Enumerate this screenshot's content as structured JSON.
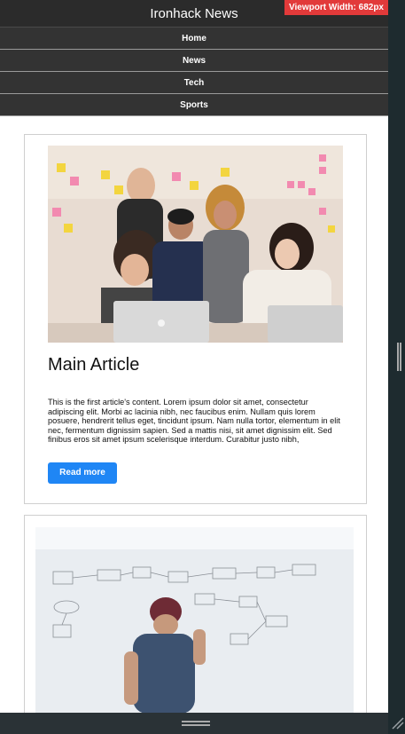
{
  "header": {
    "title": "Ironhack News",
    "viewport_badge": "Viewport Width: 682px"
  },
  "nav": {
    "items": [
      {
        "label": "Home"
      },
      {
        "label": "News"
      },
      {
        "label": "Tech"
      },
      {
        "label": "Sports"
      }
    ]
  },
  "articles": [
    {
      "title": "Main Article",
      "body": "This is the first article's content. Lorem ipsum dolor sit amet, consectetur adipiscing elit. Morbi ac lacinia nibh, nec faucibus enim. Nullam quis lorem posuere, hendrerit tellus eget, tincidunt ipsum. Nam nulla tortor, elementum in elit nec, fermentum dignissim sapien. Sed a mattis nisi, sit amet dignissim elit. Sed finibus eros sit amet ipsum scelerisque interdum. Curabitur justo nibh,",
      "button_label": "Read more"
    }
  ],
  "colors": {
    "header_bg": "#2b2b2b",
    "badge_bg": "#e23a3a",
    "button_bg": "#1f86f5"
  }
}
